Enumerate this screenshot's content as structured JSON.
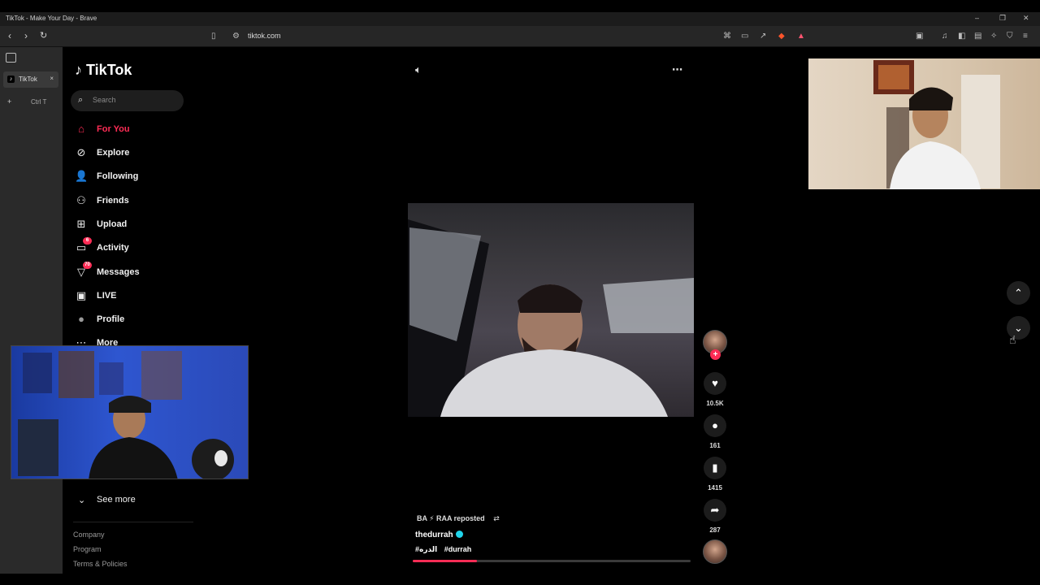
{
  "window": {
    "title": "TikTok - Make Your Day - Brave"
  },
  "browser": {
    "url": "tiktok.com",
    "tabs": [
      {
        "label": "TikTok",
        "close": "×"
      }
    ],
    "new_tab_shortcut": "Ctrl T"
  },
  "tiktok": {
    "logo": "TikTok",
    "search": {
      "placeholder": "Search"
    },
    "nav": [
      {
        "label": "For You",
        "icon": "home-icon",
        "active": true
      },
      {
        "label": "Explore",
        "icon": "compass-icon"
      },
      {
        "label": "Following",
        "icon": "user-check-icon"
      },
      {
        "label": "Friends",
        "icon": "friends-icon"
      },
      {
        "label": "Upload",
        "icon": "upload-icon"
      },
      {
        "label": "Activity",
        "icon": "activity-icon",
        "badge": "6"
      },
      {
        "label": "Messages",
        "icon": "messages-icon",
        "badge": "70"
      },
      {
        "label": "LIVE",
        "icon": "live-icon"
      },
      {
        "label": "Profile",
        "icon": "profile-icon"
      },
      {
        "label": "More",
        "icon": "more-icon"
      }
    ],
    "see_more": "See more",
    "footer": [
      "Company",
      "Program",
      "Terms & Policies"
    ],
    "video": {
      "repost_text": "BA ⚡ RAA reposted",
      "author": "thedurrah",
      "hashtags": [
        "#الدره",
        "#durrah"
      ],
      "progress": 0.23,
      "likes": "10.5K",
      "comments": "161",
      "saves": "1415",
      "shares": "287"
    }
  },
  "colors": {
    "brand": "#fe2c55",
    "verified": "#20d5ec"
  }
}
